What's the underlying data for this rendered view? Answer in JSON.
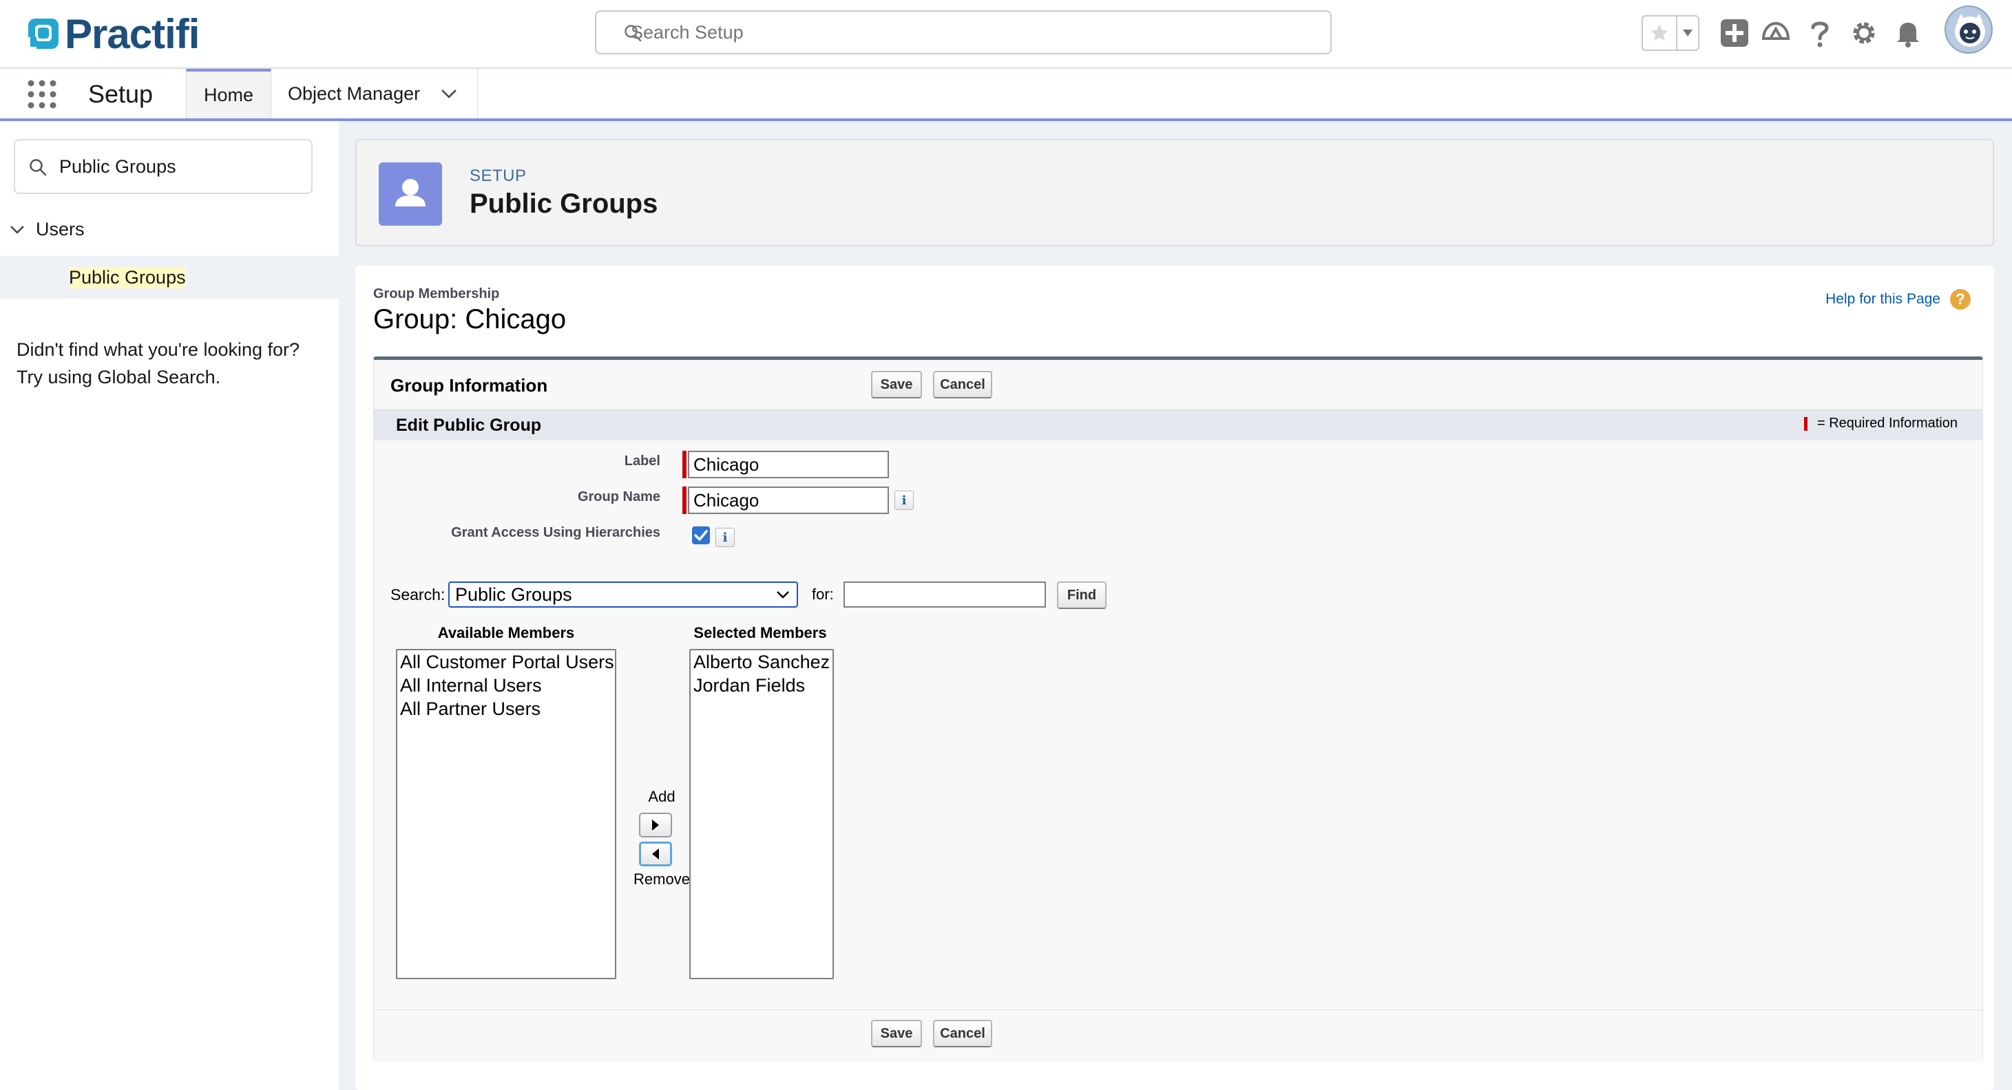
{
  "header": {
    "logo_text": "Practifi",
    "search_placeholder": "Search Setup"
  },
  "context_bar": {
    "app_name": "Setup",
    "tabs": [
      {
        "label": "Home"
      },
      {
        "label": "Object Manager"
      }
    ]
  },
  "sidebar": {
    "quick_find_value": "Public Groups",
    "tree": {
      "parent_label": "Users",
      "child_label": "Public Groups"
    },
    "not_found_line1": "Didn't find what you're looking for?",
    "not_found_line2": "Try using Global Search."
  },
  "page_header": {
    "eyebrow": "SETUP",
    "title": "Public Groups"
  },
  "content": {
    "group_membership_label": "Group Membership",
    "group_title": "Group: Chicago",
    "help_link": "Help for this Page",
    "help_icon_glyph": "?",
    "block_title": "Group Information",
    "save_label": "Save",
    "cancel_label": "Cancel",
    "section_title": "Edit Public Group",
    "required_legend": "= Required Information",
    "fields": {
      "label_label": "Label",
      "label_value": "Chicago",
      "group_name_label": "Group Name",
      "group_name_value": "Chicago",
      "grant_access_label": "Grant Access Using Hierarchies",
      "grant_access_checked": true
    },
    "info_glyph": "i",
    "search": {
      "label": "Search:",
      "selected": "Public Groups",
      "for_label": "for:",
      "for_value": "",
      "find_label": "Find"
    },
    "available_members": {
      "header": "Available Members",
      "items": [
        "All Customer Portal Users",
        "All Internal Users",
        "All Partner Users"
      ]
    },
    "selected_members": {
      "header": "Selected Members",
      "items": [
        "Alberto Sanchez",
        "Jordan Fields"
      ]
    },
    "add_label": "Add",
    "remove_label": "Remove"
  },
  "colors": {
    "brand": "#1d4f7c",
    "accent": "#8192dd",
    "setup_icon": "#7f8de1",
    "required": "#cc0000",
    "help_icon": "#e8a93b"
  }
}
